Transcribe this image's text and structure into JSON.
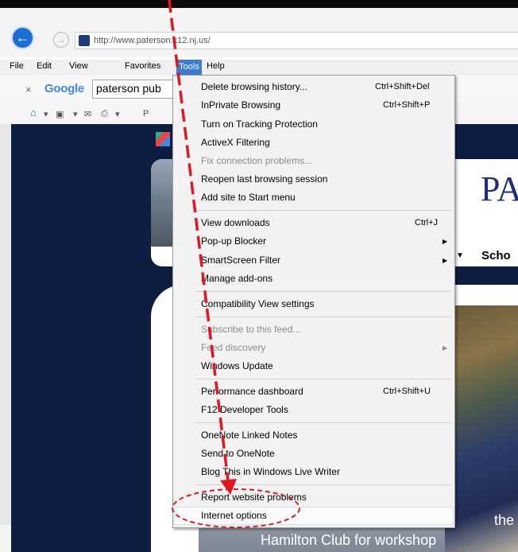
{
  "browser": {
    "url": "http://www.paterson.k12.nj.us/",
    "menubar": [
      "File",
      "Edit",
      "View",
      "Favorites",
      "Tools",
      "Help"
    ],
    "google_toolbar": {
      "logo": "Google",
      "search_text": "paterson pub"
    },
    "command_bar_partial": "P"
  },
  "tools_menu": {
    "groups": [
      [
        {
          "label": "Delete browsing history...",
          "shortcut": "Ctrl+Shift+Del",
          "enabled": true
        },
        {
          "label": "InPrivate Browsing",
          "shortcut": "Ctrl+Shift+P",
          "enabled": true
        },
        {
          "label": "Turn on Tracking Protection",
          "shortcut": "",
          "enabled": true
        },
        {
          "label": "ActiveX Filtering",
          "shortcut": "",
          "enabled": true
        },
        {
          "label": "Fix connection problems...",
          "shortcut": "",
          "enabled": false
        },
        {
          "label": "Reopen last browsing session",
          "shortcut": "",
          "enabled": true
        },
        {
          "label": "Add site to Start menu",
          "shortcut": "",
          "enabled": true
        }
      ],
      [
        {
          "label": "View downloads",
          "shortcut": "Ctrl+J",
          "enabled": true
        },
        {
          "label": "Pop-up Blocker",
          "submenu": true,
          "enabled": true
        },
        {
          "label": "SmartScreen Filter",
          "submenu": true,
          "enabled": true
        },
        {
          "label": "Manage add-ons",
          "shortcut": "",
          "enabled": true
        }
      ],
      [
        {
          "label": "Compatibility View settings",
          "shortcut": "",
          "enabled": true
        }
      ],
      [
        {
          "label": "Subscribe to this feed...",
          "shortcut": "",
          "enabled": false
        },
        {
          "label": "Feed discovery",
          "submenu": true,
          "enabled": false
        },
        {
          "label": "Windows Update",
          "shortcut": "",
          "enabled": true
        }
      ],
      [
        {
          "label": "Performance dashboard",
          "shortcut": "Ctrl+Shift+U",
          "enabled": true
        },
        {
          "label": "F12 Developer Tools",
          "shortcut": "",
          "enabled": true
        }
      ],
      [
        {
          "label": "OneNote Linked Notes",
          "shortcut": "",
          "enabled": true
        },
        {
          "label": "Send to OneNote",
          "shortcut": "",
          "enabled": true
        },
        {
          "label": "Blog This in Windows Live Writer",
          "shortcut": "",
          "enabled": true
        }
      ],
      [
        {
          "label": "Report website problems",
          "shortcut": "",
          "enabled": true
        },
        {
          "label": "Internet options",
          "shortcut": "",
          "enabled": true,
          "highlighted": true
        }
      ]
    ]
  },
  "page": {
    "banner_logo_partial": "PA",
    "nav_partial": "Scho",
    "caption_line1": "the",
    "caption_line2": "Hamilton Club for workshop"
  },
  "annotation": {
    "color": "#e0191f"
  }
}
